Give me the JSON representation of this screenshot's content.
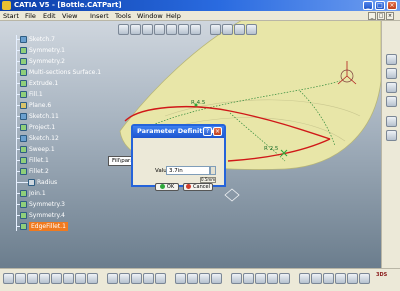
{
  "window": {
    "title": "CATIA V5 - [Bottle.CATPart]",
    "minimize": "_",
    "maximize": "□",
    "close": "×"
  },
  "menu": {
    "items": [
      "Start",
      "File",
      "Edit",
      "View",
      "Insert",
      "Tools",
      "Window",
      "Help"
    ],
    "doc_controls": [
      "_",
      "□",
      "×"
    ]
  },
  "tree": {
    "items": [
      {
        "label": "Sketch.7",
        "color": "#6aa0cf"
      },
      {
        "label": "Symmetry.1",
        "color": "#8fcf7a"
      },
      {
        "label": "Symmetry.2",
        "color": "#8fcf7a"
      },
      {
        "label": "Multi-sections Surface.1",
        "color": "#8fcf7a"
      },
      {
        "label": "Extrude.1",
        "color": "#8fcf7a"
      },
      {
        "label": "Fill.1",
        "color": "#8fcf7a"
      },
      {
        "label": "Plane.6",
        "color": "#d7c36a"
      },
      {
        "label": "Sketch.11",
        "color": "#6aa0cf"
      },
      {
        "label": "Project.1",
        "color": "#8fcf7a"
      },
      {
        "label": "Sketch.12",
        "color": "#6aa0cf"
      },
      {
        "label": "Sweep.1",
        "color": "#8fcf7a"
      },
      {
        "label": "Fillet.1",
        "color": "#8fcf7a"
      },
      {
        "label": "Fillet.2",
        "color": "#8fcf7a"
      },
      {
        "label": "Radius",
        "color": "#cfd8e0",
        "sub": true
      },
      {
        "label": "Join.1",
        "color": "#8fcf7a"
      },
      {
        "label": "Symmetry.3",
        "color": "#8fcf7a"
      },
      {
        "label": "Symmetry.4",
        "color": "#8fcf7a"
      },
      {
        "label": "EdgeFillet.1",
        "color": "#8fcf7a",
        "selected": true
      }
    ]
  },
  "viewport": {
    "tags": [
      "R 4.5",
      "R 2.5"
    ],
    "tooltip": "Fill\\parameter.7"
  },
  "dialog": {
    "title": "Parameter Definition",
    "help": "?",
    "close": "×",
    "value_label": "Value",
    "value": "3.7in",
    "range": "0.5mm",
    "ok_label": "OK",
    "cancel_label": "Cancel"
  },
  "colors": {
    "title_bar": "#1d55cf",
    "surface": "#e8e6a8",
    "edge_highlight": "#d01818",
    "selection": "#f07a1f"
  }
}
